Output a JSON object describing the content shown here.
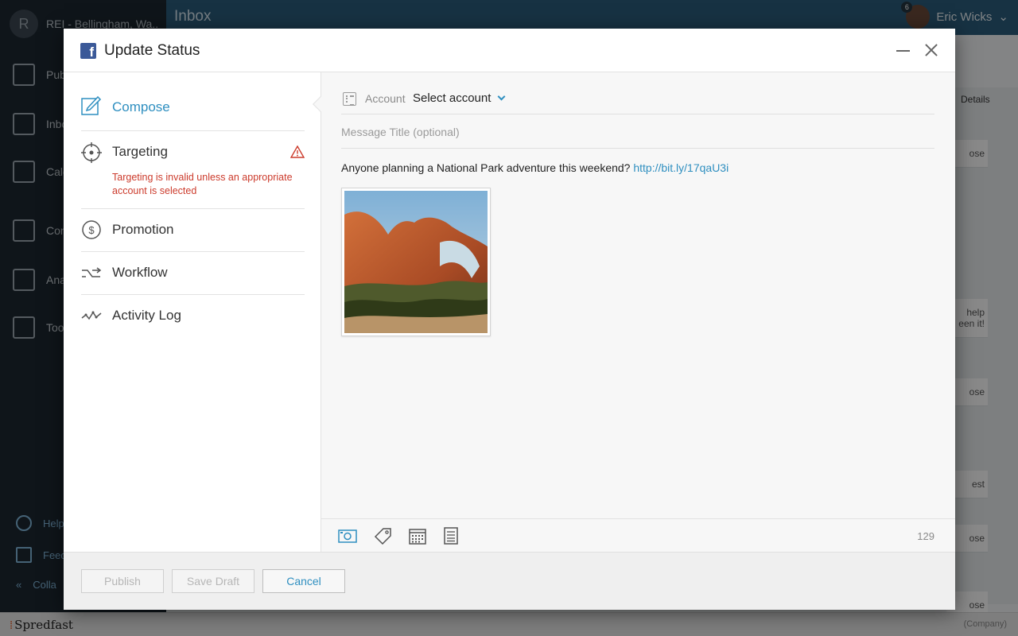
{
  "background_app": {
    "org_initial": "R",
    "org_name": "REI - Bellingham, Wa...",
    "title": "Inbox",
    "user": {
      "name": "Eric Wicks",
      "badge": "6"
    },
    "nav": [
      "Pub",
      "Inbo",
      "Cale",
      "Con",
      "Ana",
      "Too"
    ],
    "bottom": [
      "Help",
      "Feed",
      "Colla"
    ],
    "right_tab": "Details",
    "right_fragments": [
      "ose",
      "help",
      "een it!",
      "ose",
      "est",
      "ose",
      "ose"
    ]
  },
  "modal": {
    "title": "Update Status",
    "nav": [
      {
        "label": "Compose",
        "icon": "compose-icon",
        "active": true
      },
      {
        "label": "Targeting",
        "icon": "target-icon",
        "error": "Targeting is invalid unless an appropriate account is selected"
      },
      {
        "label": "Promotion",
        "icon": "dollar-icon"
      },
      {
        "label": "Workflow",
        "icon": "workflow-icon"
      },
      {
        "label": "Activity Log",
        "icon": "activity-icon"
      }
    ],
    "account": {
      "label": "Account",
      "value": "Select account"
    },
    "message_title_placeholder": "Message Title (optional)",
    "message_text": "Anyone planning a National Park adventure this weekend?",
    "message_link": "http://bit.ly/17qaU3i",
    "char_count": "129",
    "toolbar": [
      "photo-icon",
      "tag-icon",
      "calendar-icon",
      "page-icon"
    ],
    "buttons": {
      "publish": "Publish",
      "save_draft": "Save Draft",
      "cancel": "Cancel"
    }
  },
  "footer": {
    "brand": "Spredfast",
    "company": "(Company)"
  },
  "colors": {
    "accent": "#2f8fc0",
    "error": "#cc3b2c",
    "facebook": "#3b5998",
    "brand_mark": "#e05a24"
  }
}
